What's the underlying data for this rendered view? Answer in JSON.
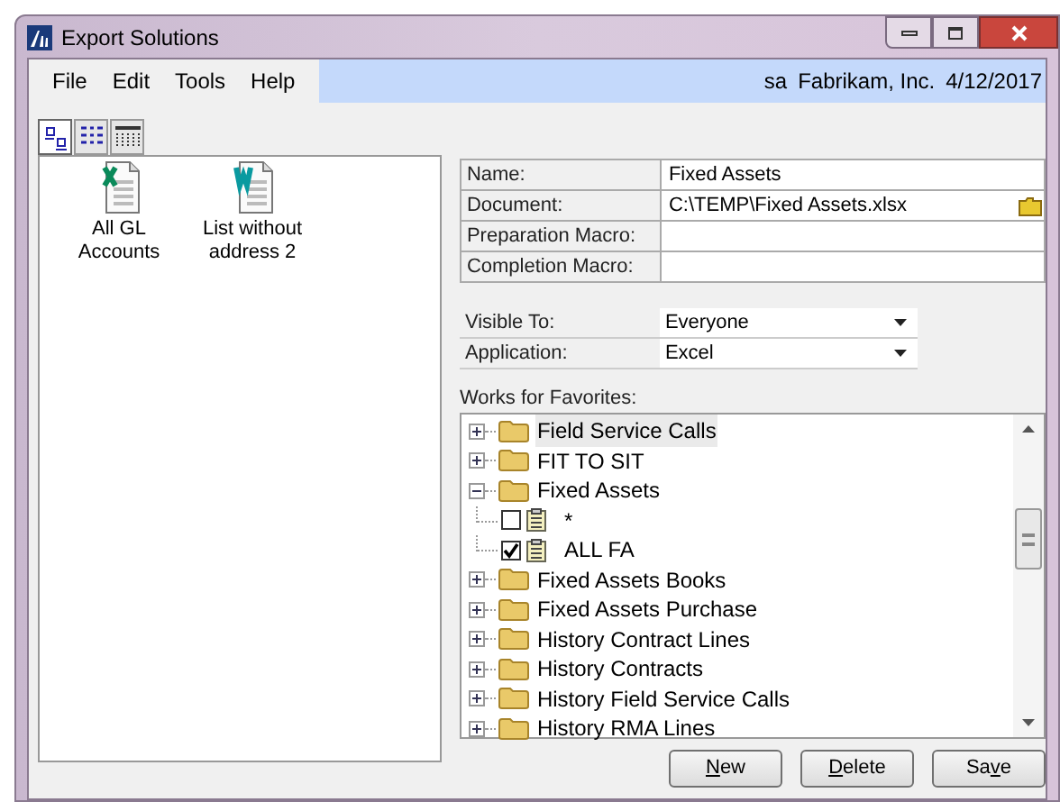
{
  "window": {
    "title": "Export Solutions"
  },
  "menu": [
    "File",
    "Edit",
    "Tools",
    "Help"
  ],
  "status": {
    "user": "sa",
    "company": "Fabrikam, Inc.",
    "date": "4/12/2017"
  },
  "view_buttons": [
    {
      "kind": "icons",
      "selected": true
    },
    {
      "kind": "list",
      "selected": false
    },
    {
      "kind": "details",
      "selected": false
    }
  ],
  "solutions": [
    {
      "label": "All GL Accounts",
      "kind": "excel"
    },
    {
      "label": "List without address 2",
      "kind": "word"
    }
  ],
  "fields": [
    {
      "label": "Name:",
      "value": "Fixed Assets",
      "browse": false
    },
    {
      "label": "Document:",
      "value": "C:\\TEMP\\Fixed Assets.xlsx",
      "browse": true
    },
    {
      "label": "Preparation Macro:",
      "browse": false
    },
    {
      "label": "Completion Macro:",
      "browse": false
    }
  ],
  "dropdowns": [
    {
      "label": "Visible To:",
      "value": "Everyone"
    },
    {
      "label": "Application:",
      "value": "Excel"
    }
  ],
  "favorites": {
    "label": "Works for Favorites:",
    "items": [
      {
        "label": "Field Service Calls",
        "expanded": false,
        "selected": true
      },
      {
        "label": "FIT TO SIT",
        "expanded": false,
        "selected": false
      },
      {
        "label": "Fixed Assets",
        "expanded": true,
        "selected": false,
        "children": [
          {
            "label": "*",
            "checked": false,
            "selected": false
          },
          {
            "label": "ALL FA",
            "checked": true,
            "selected": false
          }
        ]
      },
      {
        "label": "Fixed Assets Books",
        "expanded": false,
        "selected": false
      },
      {
        "label": "Fixed Assets Purchase",
        "expanded": false,
        "selected": false
      },
      {
        "label": "History Contract Lines",
        "expanded": false,
        "selected": false
      },
      {
        "label": "History Contracts",
        "expanded": false,
        "selected": false
      },
      {
        "label": "History Field Service Calls",
        "expanded": false,
        "selected": false
      },
      {
        "label": "History RMA Lines",
        "expanded": false,
        "selected": false
      }
    ]
  },
  "buttons": [
    {
      "access_key": "N",
      "after": "ew"
    },
    {
      "access_key": "D",
      "after": "elete"
    },
    {
      "before": "Sa",
      "access_key": "v",
      "after": "e"
    }
  ]
}
